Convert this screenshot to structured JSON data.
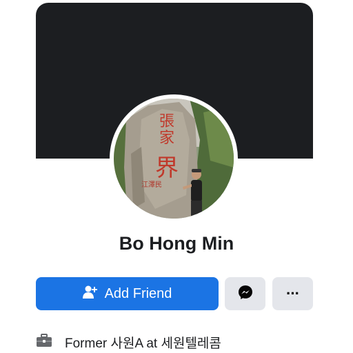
{
  "profile": {
    "name": "Bo Hong Min",
    "avatar_icon": "profile-photo"
  },
  "actions": {
    "add_friend_label": "Add Friend",
    "add_friend_icon": "person-add-icon",
    "message_icon": "messenger-icon",
    "more_icon": "more-dots-icon",
    "more_glyph": "···"
  },
  "intro": {
    "work_icon": "briefcase-icon",
    "work_text": "Former 사원A at 세원텔레콤"
  },
  "colors": {
    "cover": "#1c1e21",
    "primary_button": "#1b74e4",
    "secondary_button": "#e4e6eb"
  }
}
